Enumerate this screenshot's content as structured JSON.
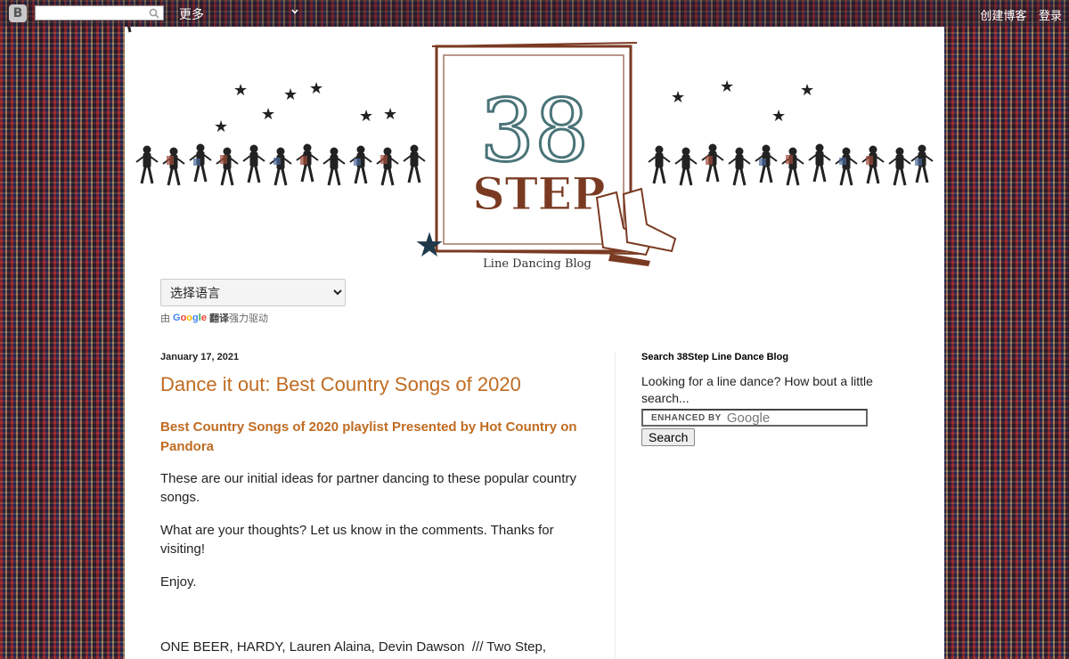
{
  "navbar": {
    "more_label": "更多",
    "create_blog": "创建博客",
    "sign_in": "登录"
  },
  "header": {
    "logo_number": "38",
    "logo_word": "STEP",
    "logo_tagline": "Line Dancing Blog"
  },
  "translate": {
    "select_label": "选择语言",
    "powered_prefix": "由",
    "google_word": "Google",
    "translate_word": "翻译",
    "powered_suffix": "强力驱动"
  },
  "post": {
    "date": "January 17, 2021",
    "title": "Dance it out: Best Country Songs of 2020",
    "subheading": "Best Country Songs of 2020 playlist Presented by Hot Country on Pandora",
    "para1": "These are our initial ideas for partner dancing to these popular country songs.",
    "para2": "What are your thoughts? Let us know in the comments. Thanks for visiting!",
    "para3": "Enjoy.",
    "para4": "ONE BEER, HARDY, Lauren Alaina, Devin Dawson  /// Two Step,"
  },
  "sidebar": {
    "widget_title": "Search 38Step Line Dance Blog",
    "description": "Looking for a line dance? How bout a little search...",
    "search_enhanced": "ENHANCED BY",
    "search_google": "Google",
    "search_button": "Search"
  },
  "colors": {
    "accent": "#c06b21",
    "logo_teal": "#4a7478",
    "logo_brown": "#7a3a22"
  }
}
